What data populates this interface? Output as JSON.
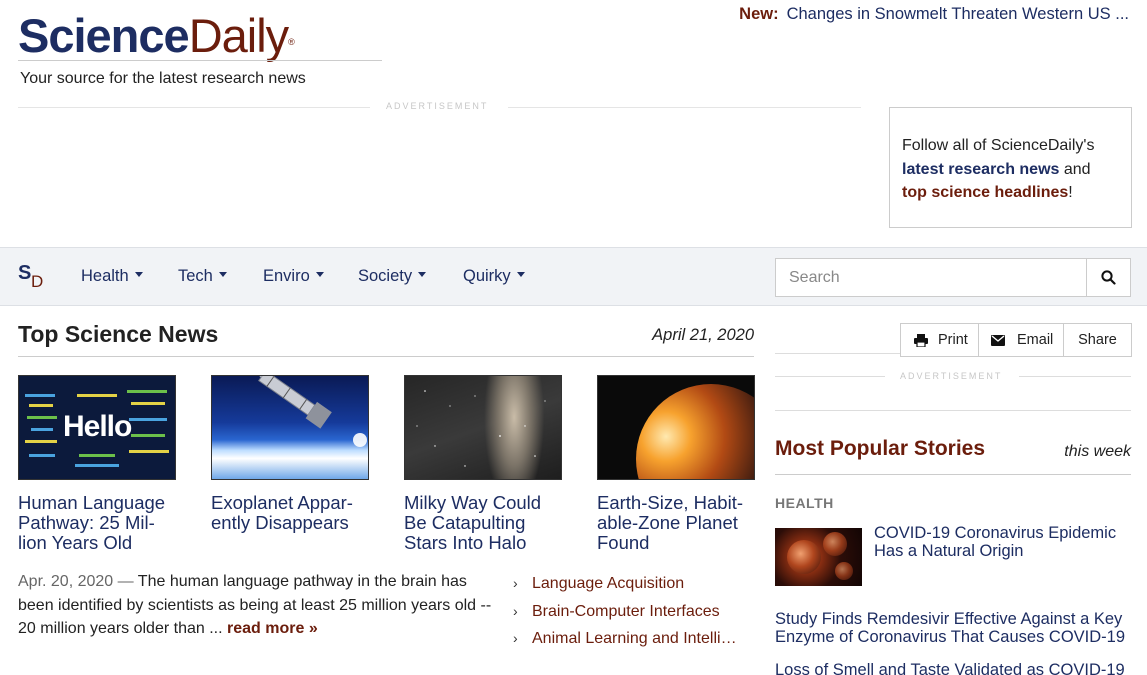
{
  "header": {
    "logo_science": "Science",
    "logo_daily": "Daily",
    "logo_reg": "®",
    "tagline": "Your source for the latest research news",
    "new_label": "New:",
    "new_link": "Changes in Snowmelt Threaten Western US ..."
  },
  "ads": {
    "top_label": "ADVERTISEMENT",
    "side_label": "ADVERTISEMENT"
  },
  "follow_box": {
    "line1": "Follow all of ScienceDaily's",
    "link_latest": "latest research news",
    "and": " and",
    "link_top": "top science headlines",
    "bang": "!"
  },
  "nav": {
    "logo_s": "S",
    "logo_d": "D",
    "items": [
      {
        "label": "Health"
      },
      {
        "label": "Tech"
      },
      {
        "label": "Enviro"
      },
      {
        "label": "Society"
      },
      {
        "label": "Quirky"
      }
    ],
    "search_placeholder": "Search",
    "search_icon": "magnifier-icon"
  },
  "main": {
    "title": "Top Science News",
    "date": "April 21, 2020",
    "stories": [
      {
        "title": "Human Language Pathway: 25 Mil- lion Years Old",
        "thumb": "hello-words"
      },
      {
        "title": "Exoplanet Appar- ently Disappears",
        "thumb": "satellite-earth"
      },
      {
        "title": "Milky Way Could Be Catapulting Stars Into Halo",
        "thumb": "milky-way"
      },
      {
        "title": "Earth-Size, Habit- able-Zone Planet Found",
        "thumb": "planet-sunrise"
      }
    ],
    "thumb_hello_word": "Hello",
    "summary_date": "Apr. 20, 2020 —",
    "summary_text": " The human language pathway in the brain has been identified by scientists as being at least 25 million years old -- 20 million years older than ... ",
    "read_more": "read more »",
    "related": [
      {
        "label": "Language Acquisition"
      },
      {
        "label": "Brain-Computer Interfaces"
      },
      {
        "label": "Animal Learning and Intelli…"
      }
    ]
  },
  "sidebar": {
    "share_buttons": [
      {
        "label": "Print",
        "icon": "printer-icon"
      },
      {
        "label": "Email",
        "icon": "envelope-icon"
      },
      {
        "label": "Share",
        "icon": ""
      }
    ],
    "popular_title": "Most Popular Stories",
    "popular_period": "this week",
    "category": "HEALTH",
    "stories": [
      {
        "title": "COVID-19 Coronavirus Epidemic Has a Natural Origin"
      },
      {
        "title": "Study Finds Remdesivir Effective Against a Key Enzyme of Coronavirus That Causes COVID-19"
      },
      {
        "title": "Loss of Smell and Taste Validated as COVID-19"
      }
    ]
  },
  "colors": {
    "navy": "#1d2d62",
    "maroon": "#6b1d0c",
    "nav_bg": "#f1f3f6"
  }
}
